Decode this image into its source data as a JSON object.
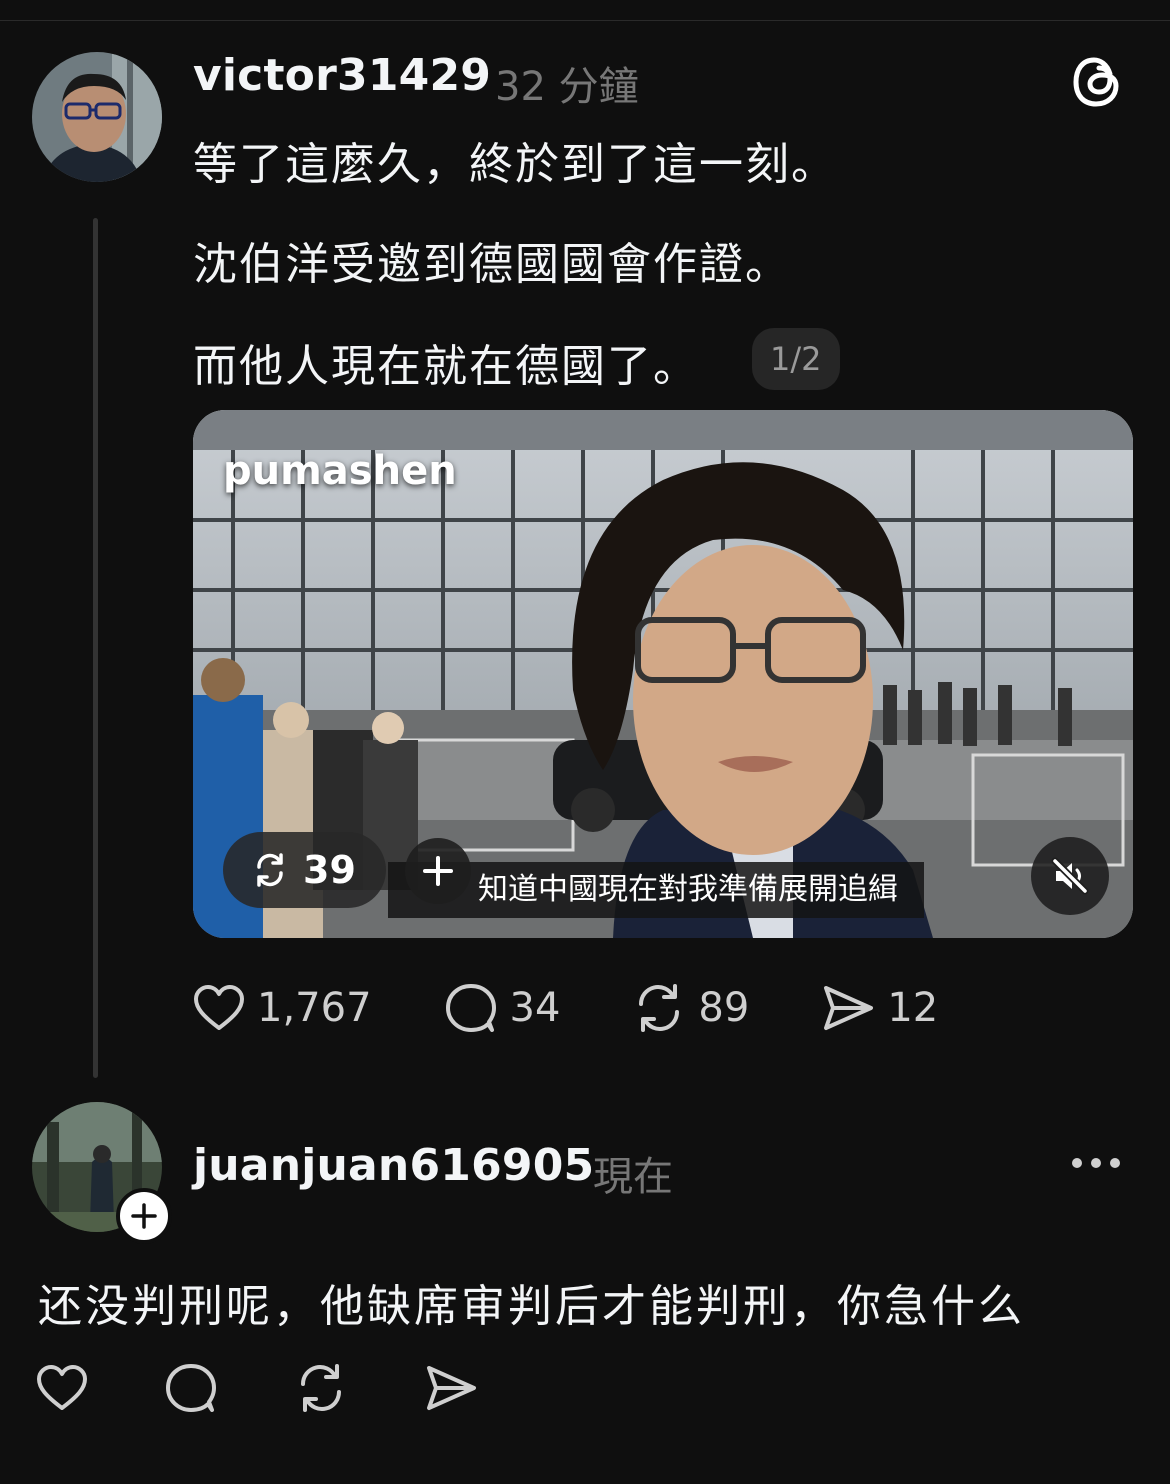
{
  "post": {
    "username": "victor31429",
    "time": "32 分鐘",
    "lines": [
      "等了這麼久，終於到了這一刻。",
      "沈伯洋受邀到德國國會作證。",
      "而他人現在就在德國了。"
    ],
    "page_indicator": "1/2",
    "media": {
      "source": "pumashen",
      "repost_count": "39",
      "subtitle": "知道中國現在對我準備展開追緝"
    },
    "stats": {
      "likes": "1,767",
      "replies": "34",
      "reposts": "89",
      "shares": "12"
    }
  },
  "reply": {
    "username": "juanjuan616905",
    "time": "現在",
    "text": "还没判刑呢，他缺席审判后才能判刑，你急什么"
  },
  "icons": {
    "app_logo": "threads-icon",
    "like": "heart-icon",
    "reply": "comment-icon",
    "repost": "repost-icon",
    "share": "send-icon",
    "more": "more-dots-icon",
    "mute": "muted-speaker-icon",
    "follow": "plus-icon"
  },
  "colors": {
    "background": "#0f0f0f",
    "text": "#f3f5f7",
    "muted": "#777777"
  }
}
